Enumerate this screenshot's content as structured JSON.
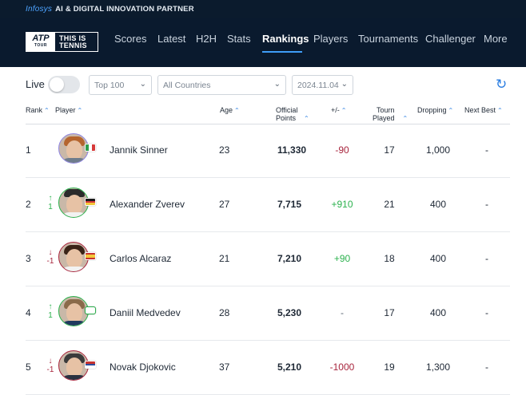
{
  "partner": {
    "brand": "Infosys",
    "text": "AI & DIGITAL INNOVATION PARTNER"
  },
  "logo": {
    "mark": "ATP",
    "sub": "TOUR",
    "line1": "THIS IS",
    "line2": "TENNIS"
  },
  "nav": {
    "items": [
      "Scores",
      "Latest",
      "H2H",
      "Stats",
      "Rankings",
      "Players",
      "Tournaments",
      "Challenger",
      "More"
    ],
    "active": "Rankings"
  },
  "filters": {
    "live_label": "Live",
    "live_on": false,
    "range": "Top 100",
    "country": "All Countries",
    "date": "2024.11.04"
  },
  "columns": {
    "rank": "Rank",
    "player": "Player",
    "age": "Age",
    "points_l1": "Official",
    "points_l2": "Points",
    "change": "+/-",
    "played_l1": "Tourn",
    "played_l2": "Played",
    "dropping": "Dropping",
    "next_best": "Next Best"
  },
  "rows": [
    {
      "rank": "1",
      "move_arrow": "",
      "move_value": "",
      "move_dir": "none",
      "name": "Jannik Sinner",
      "age": "23",
      "points": "11,330",
      "change": "-90",
      "change_dir": "neg",
      "played": "17",
      "dropping": "1,000",
      "next_best": "-",
      "flag": "italy"
    },
    {
      "rank": "2",
      "move_arrow": "↑",
      "move_value": "1",
      "move_dir": "up",
      "name": "Alexander Zverev",
      "age": "27",
      "points": "7,715",
      "change": "+910",
      "change_dir": "pos",
      "played": "21",
      "dropping": "400",
      "next_best": "-",
      "flag": "germany"
    },
    {
      "rank": "3",
      "move_arrow": "↓",
      "move_value": "-1",
      "move_dir": "down",
      "name": "Carlos Alcaraz",
      "age": "21",
      "points": "7,210",
      "change": "+90",
      "change_dir": "pos",
      "played": "18",
      "dropping": "400",
      "next_best": "-",
      "flag": "spain"
    },
    {
      "rank": "4",
      "move_arrow": "↑",
      "move_value": "1",
      "move_dir": "up",
      "name": "Daniil Medvedev",
      "age": "28",
      "points": "5,230",
      "change": "-",
      "change_dir": "none",
      "played": "17",
      "dropping": "400",
      "next_best": "-",
      "flag": "neutral"
    },
    {
      "rank": "5",
      "move_arrow": "↓",
      "move_value": "-1",
      "move_dir": "down",
      "name": "Novak Djokovic",
      "age": "37",
      "points": "5,210",
      "change": "-1000",
      "change_dir": "neg",
      "played": "19",
      "dropping": "1,300",
      "next_best": "-",
      "flag": "serbia"
    }
  ],
  "colors": {
    "nav_bg": "#0a1a2e",
    "accent": "#2a7de1",
    "positive": "#2cb24e",
    "negative": "#a8253d"
  }
}
